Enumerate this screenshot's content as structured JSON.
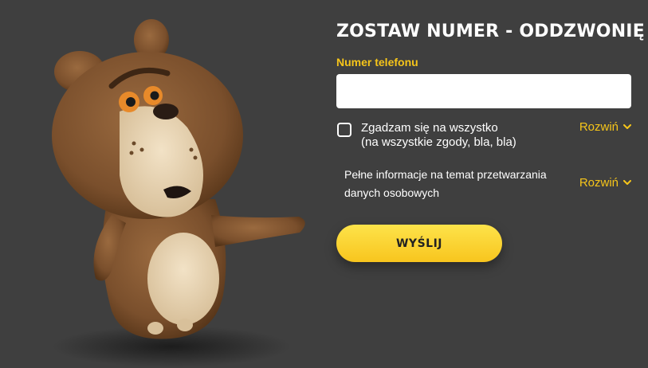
{
  "form": {
    "title": "ZOSTAW NUMER - ODDZWONIĘ",
    "phone_label": "Numer telefonu",
    "phone_value": "",
    "phone_placeholder": "",
    "consent_line1": "Zgadzam się na wszystko",
    "consent_line2": "(na wszystkie zgody, bla, bla)",
    "consent_checked": false,
    "consent_expand_label": "Rozwiń",
    "info_text": "Pełne informacje na temat przetwarzania danych osobowych",
    "info_expand_label": "Rozwiń",
    "submit_label": "WYŚLIJ"
  },
  "mascot": {
    "icon": "bear-mascot-illustration"
  },
  "colors": {
    "background": "#3f3f3f",
    "accent": "#f6c51a",
    "text": "#ffffff",
    "button": "#fcd530"
  }
}
